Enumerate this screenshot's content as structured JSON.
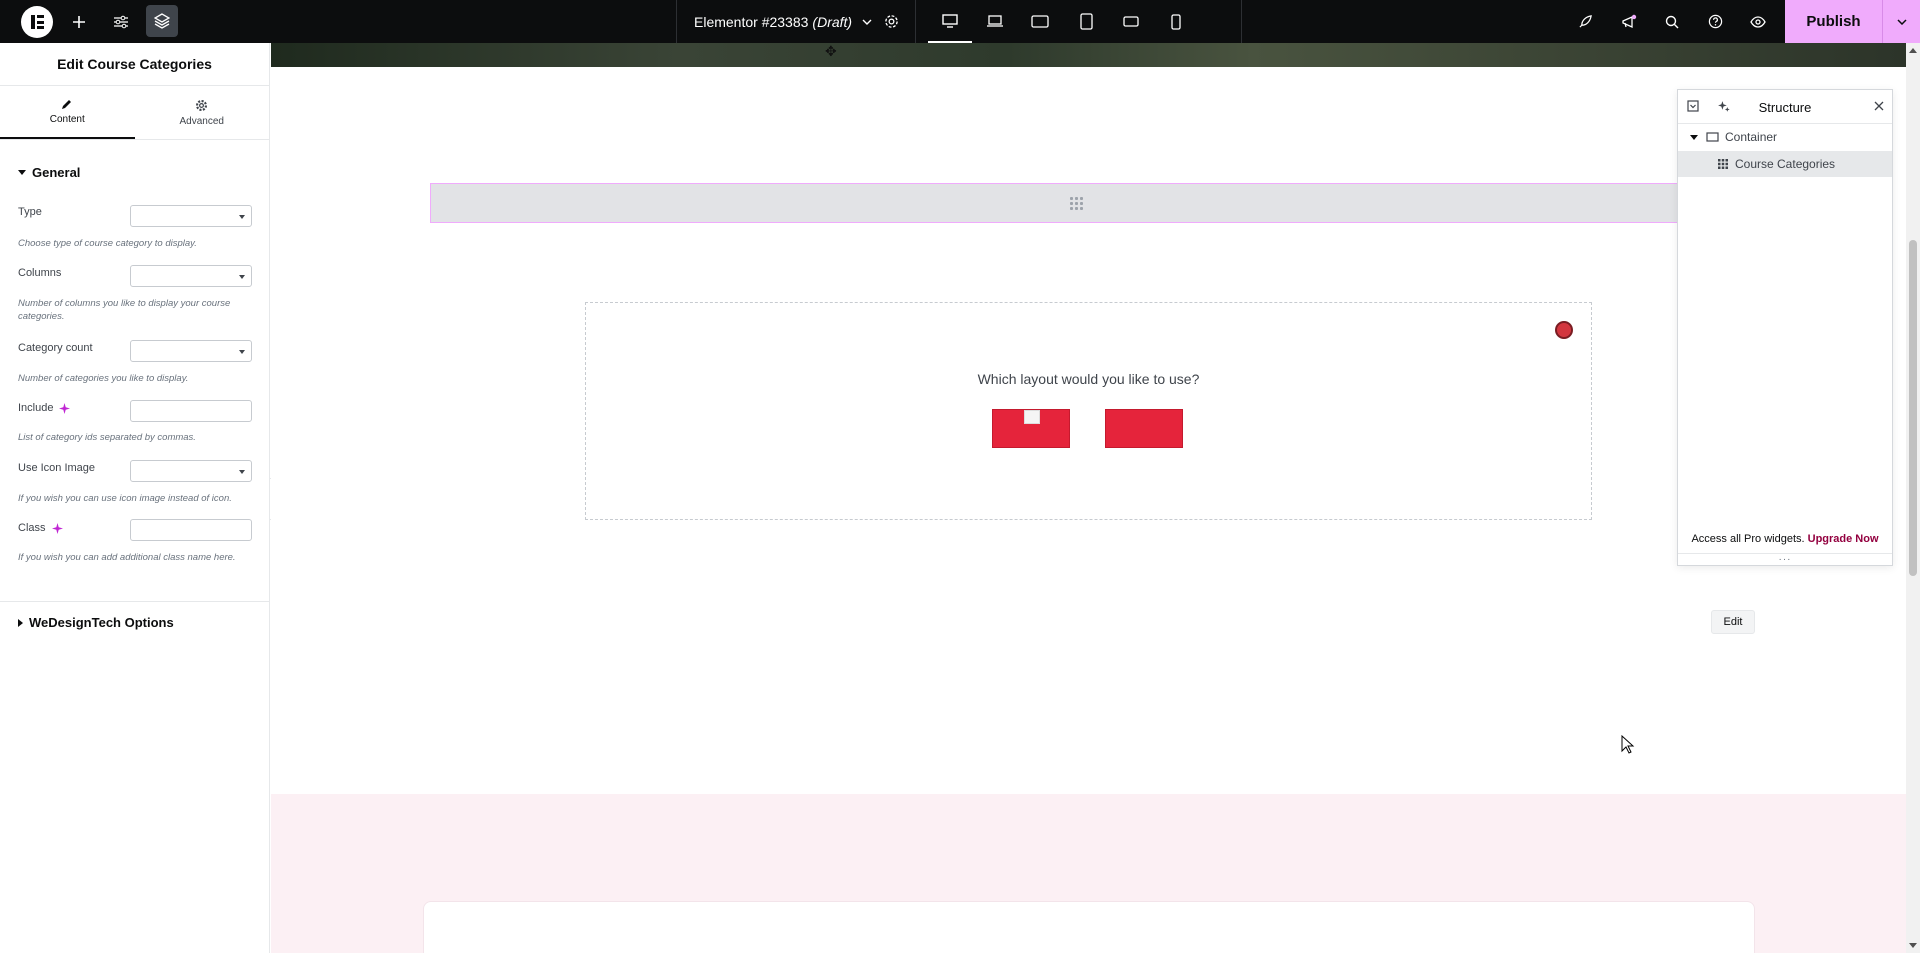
{
  "topbar": {
    "doc_title": "Elementor #23383",
    "doc_status": "(Draft)",
    "publish_label": "Publish"
  },
  "panel": {
    "title": "Edit Course Categories",
    "tabs": [
      {
        "label": "Content",
        "icon": "pencil-icon",
        "active": true
      },
      {
        "label": "Advanced",
        "icon": "gear-icon",
        "active": false
      }
    ],
    "general_section": "General",
    "controls": [
      {
        "label": "Type",
        "kind": "select",
        "desc": "Choose type of course category to display."
      },
      {
        "label": "Columns",
        "kind": "select",
        "desc": "Number of columns you like to display your course categories."
      },
      {
        "label": "Category count",
        "kind": "select",
        "desc": "Number of categories you like to display."
      },
      {
        "label": "Include",
        "kind": "text",
        "ai": true,
        "desc": "List of category ids separated by commas."
      },
      {
        "label": "Use Icon Image",
        "kind": "select",
        "desc": "If you wish you can use icon image instead of icon."
      },
      {
        "label": "Class",
        "kind": "text",
        "ai": true,
        "desc": "If you wish you can add additional class name here."
      }
    ],
    "options_section": "WeDesignTech Options"
  },
  "canvas": {
    "layout_question": "Which layout would you like to use?",
    "edit_label": "Edit"
  },
  "structure": {
    "title": "Structure",
    "items": [
      {
        "label": "Container",
        "icon": "container-icon"
      },
      {
        "label": "Course Categories",
        "icon": "grid-icon"
      }
    ],
    "footer_text": "Access all Pro widgets.",
    "footer_link": "Upgrade Now",
    "grip": "···"
  },
  "colors": {
    "topbar_bg": "#0c0d0e",
    "publish_bg": "#f0abfc",
    "accent_red": "#e5243b",
    "upgrade_link": "#93003f",
    "pink_section": "#fcf0f4"
  }
}
